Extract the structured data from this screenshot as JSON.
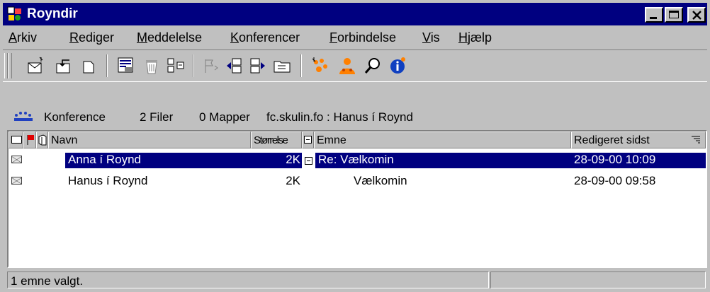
{
  "window": {
    "title": "Royndir"
  },
  "menu": [
    "Arkiv",
    "Rediger",
    "Meddelelse",
    "Konferencer",
    "Forbindelse",
    "Vis",
    "Hjælp"
  ],
  "toolbar": {
    "icons": [
      "new-message-icon",
      "reply-icon",
      "forward-icon",
      "send-receive-icon",
      "delete-icon",
      "move-icon",
      "flag-icon",
      "previous-icon",
      "next-icon",
      "folder-icon",
      "conference-icon",
      "user-icon",
      "search-icon",
      "info-icon"
    ]
  },
  "info": {
    "type": "Konference",
    "files": "2 Filer",
    "folders": "0 Mapper",
    "path": "fc.skulin.fo : Hanus í Roynd"
  },
  "list": {
    "headers": {
      "name": "Navn",
      "size": "Størrelse",
      "subject": "Emne",
      "modified": "Redigeret sidst"
    },
    "rows": [
      {
        "name": "Anna í Roynd",
        "size": "2K",
        "subject": "Re: Vælkomin",
        "modified": "28-09-00 10:09",
        "selected": true
      },
      {
        "name": "Hanus í Roynd",
        "size": "2K",
        "subject": "Vælkomin",
        "modified": "28-09-00 09:58",
        "selected": false
      }
    ]
  },
  "status": {
    "text": "1 emne valgt."
  },
  "colors": {
    "titlebar": "#000080",
    "selection": "#000080",
    "face": "#c0c0c0"
  }
}
